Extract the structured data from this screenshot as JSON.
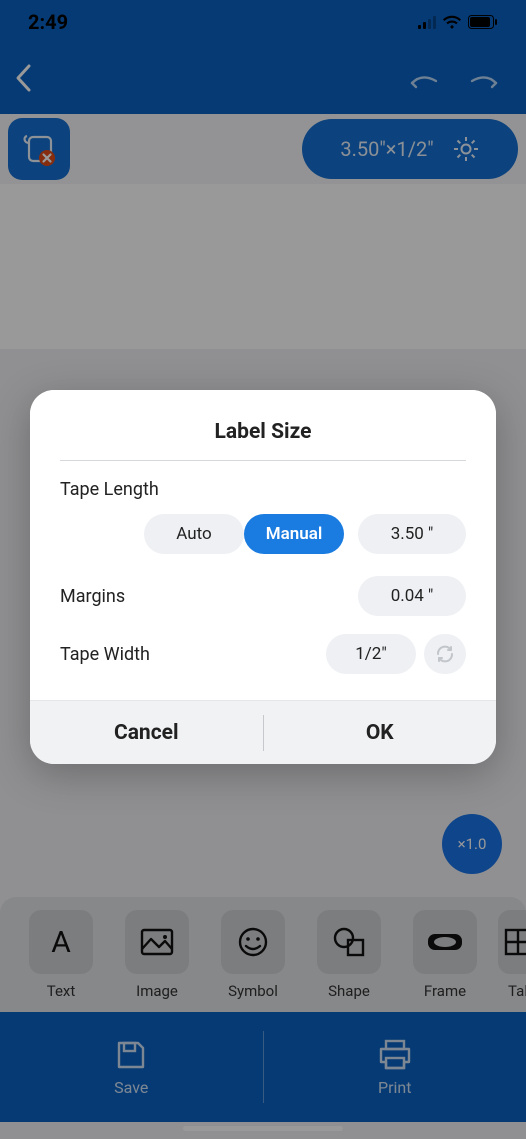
{
  "status": {
    "time": "2:49"
  },
  "toolbar": {
    "size_display": "3.50\"×1/2\""
  },
  "zoom": {
    "label": "×1.0"
  },
  "tools": {
    "items": [
      {
        "name": "text-tool",
        "label": "Text"
      },
      {
        "name": "image-tool",
        "label": "Image"
      },
      {
        "name": "symbol-tool",
        "label": "Symbol"
      },
      {
        "name": "shape-tool",
        "label": "Shape"
      },
      {
        "name": "frame-tool",
        "label": "Frame"
      },
      {
        "name": "table-tool",
        "label": "Tal"
      }
    ]
  },
  "actions": {
    "save": "Save",
    "print": "Print"
  },
  "modal": {
    "title": "Label Size",
    "tape_length_label": "Tape Length",
    "auto_label": "Auto",
    "manual_label": "Manual",
    "length_value": "3.50",
    "length_unit": "\"",
    "margins_label": "Margins",
    "margins_value": "0.04",
    "margins_unit": "\"",
    "tape_width_label": "Tape Width",
    "tape_width_value": "1/2\"",
    "cancel": "Cancel",
    "ok": "OK"
  }
}
